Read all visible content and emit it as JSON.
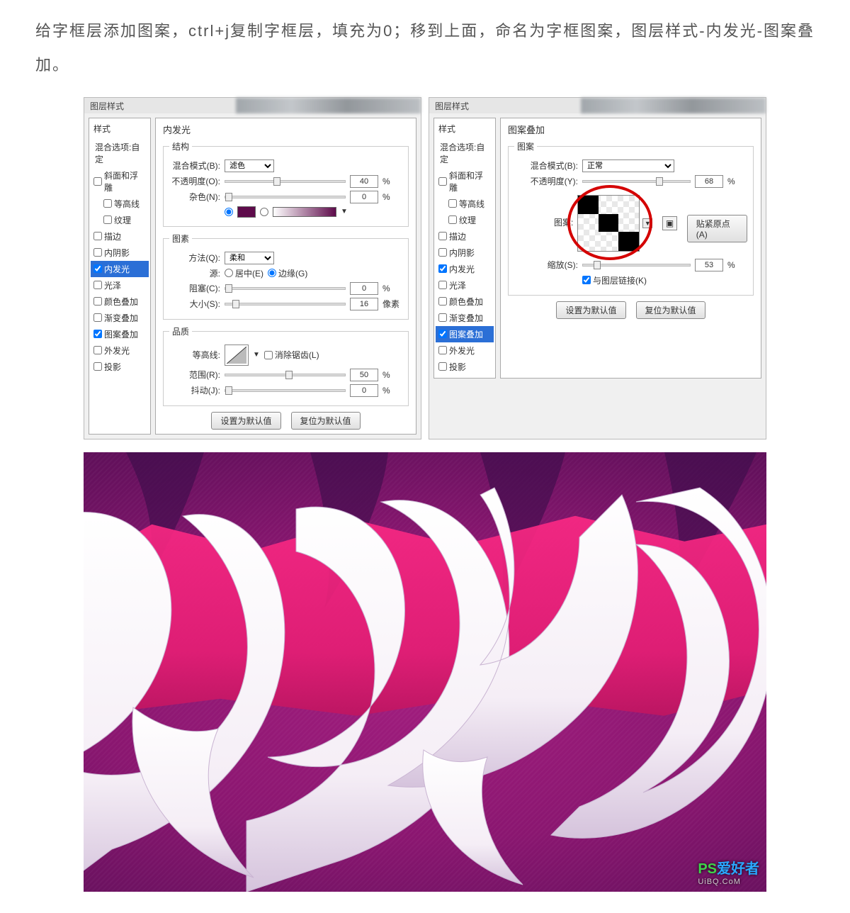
{
  "article": {
    "paragraph": "给字框层添加图案，ctrl+j复制字框层，填充为0；移到上面，命名为字框图案，图层样式-内发光-图案叠加。"
  },
  "dialog_left": {
    "title": "图层样式",
    "styles_header": "样式",
    "blend_options": "混合选项:自定",
    "items": [
      {
        "label": "斜面和浮雕",
        "checked": false
      },
      {
        "label": "等高线",
        "checked": false,
        "indent": true
      },
      {
        "label": "纹理",
        "checked": false,
        "indent": true
      },
      {
        "label": "描边",
        "checked": false
      },
      {
        "label": "内阴影",
        "checked": false
      },
      {
        "label": "内发光",
        "checked": true,
        "selected": true
      },
      {
        "label": "光泽",
        "checked": false
      },
      {
        "label": "颜色叠加",
        "checked": false
      },
      {
        "label": "渐变叠加",
        "checked": false
      },
      {
        "label": "图案叠加",
        "checked": true
      },
      {
        "label": "外发光",
        "checked": false
      },
      {
        "label": "投影",
        "checked": false
      }
    ],
    "panel_title": "内发光",
    "group_structure": "结构",
    "blend_mode_label": "混合模式(B):",
    "blend_mode_value": "滤色",
    "opacity_label": "不透明度(O):",
    "opacity_value": "40",
    "percent": "%",
    "noise_label": "杂色(N):",
    "noise_value": "0",
    "color_hex": "#5e0b4b",
    "group_elements": "图素",
    "technique_label": "方法(Q):",
    "technique_value": "柔和",
    "source_label": "源:",
    "source_center": "居中(E)",
    "source_edge": "边缘(G)",
    "choke_label": "阻塞(C):",
    "choke_value": "0",
    "size_label": "大小(S):",
    "size_value": "16",
    "px": "像素",
    "group_quality": "品质",
    "contour_label": "等高线:",
    "antialias": "消除锯齿(L)",
    "range_label": "范围(R):",
    "range_value": "50",
    "jitter_label": "抖动(J):",
    "jitter_value": "0",
    "make_default": "设置为默认值",
    "reset_default": "复位为默认值"
  },
  "dialog_right": {
    "title": "图层样式",
    "styles_header": "样式",
    "blend_options": "混合选项:自定",
    "items": [
      {
        "label": "斜面和浮雕",
        "checked": false
      },
      {
        "label": "等高线",
        "checked": false,
        "indent": true
      },
      {
        "label": "纹理",
        "checked": false,
        "indent": true
      },
      {
        "label": "描边",
        "checked": false
      },
      {
        "label": "内阴影",
        "checked": false
      },
      {
        "label": "内发光",
        "checked": true
      },
      {
        "label": "光泽",
        "checked": false
      },
      {
        "label": "颜色叠加",
        "checked": false
      },
      {
        "label": "渐变叠加",
        "checked": false
      },
      {
        "label": "图案叠加",
        "checked": true,
        "selected": true
      },
      {
        "label": "外发光",
        "checked": false
      },
      {
        "label": "投影",
        "checked": false
      }
    ],
    "panel_title": "图案叠加",
    "group_pattern": "图案",
    "blend_mode_label": "混合模式(B):",
    "blend_mode_value": "正常",
    "opacity_label": "不透明度(Y):",
    "opacity_value": "68",
    "percent": "%",
    "pattern_label": "图案:",
    "snap_origin": "贴紧原点(A)",
    "scale_label": "缩放(S):",
    "scale_value": "53",
    "link_layer": "与图层链接(K)",
    "make_default": "设置为默认值",
    "reset_default": "复位为默认值"
  },
  "watermark": {
    "ps": "PS",
    "cn": "爱好者",
    "sub": "UiBQ.CoM"
  }
}
